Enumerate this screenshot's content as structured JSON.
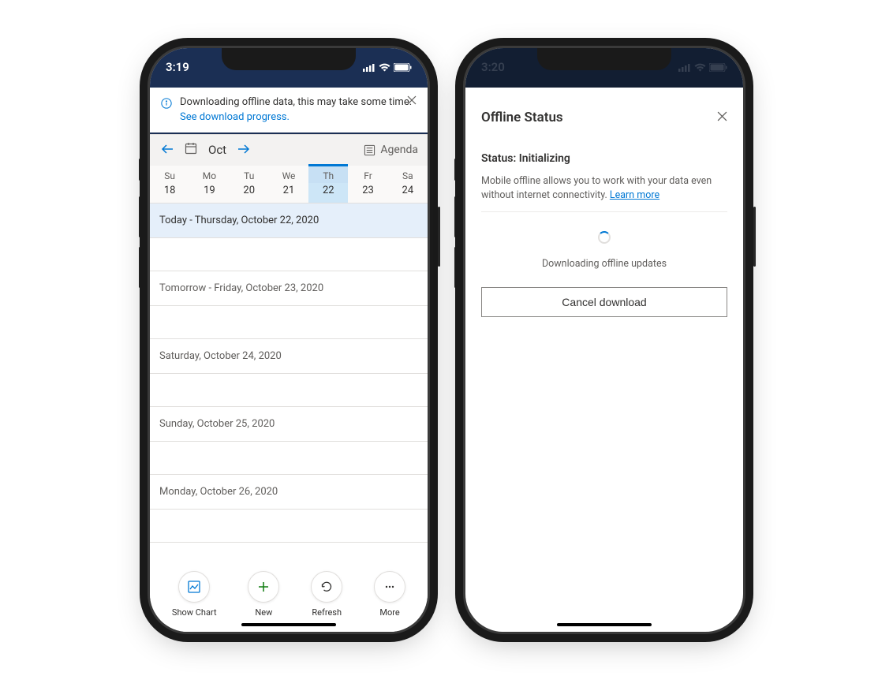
{
  "phone_left": {
    "status_time": "3:19",
    "banner": {
      "message": "Downloading offline data, this may take some time.",
      "link": "See download progress."
    },
    "calendar": {
      "month": "Oct",
      "agenda_label": "Agenda",
      "week_days": [
        "Su",
        "Mo",
        "Tu",
        "We",
        "Th",
        "Fr",
        "Sa"
      ],
      "week_dates": [
        "18",
        "19",
        "20",
        "21",
        "22",
        "23",
        "24"
      ],
      "selected_index": 4,
      "agenda_items": [
        "Today - Thursday, October 22, 2020",
        "Tomorrow - Friday, October 23, 2020",
        "Saturday, October 24, 2020",
        "Sunday, October 25, 2020",
        "Monday, October 26, 2020"
      ]
    },
    "bottom_buttons": [
      {
        "label": "Show Chart"
      },
      {
        "label": "New"
      },
      {
        "label": "Refresh"
      },
      {
        "label": "More"
      }
    ]
  },
  "phone_right": {
    "status_time": "3:20",
    "title": "Offline Status",
    "status_label": "Status: Initializing",
    "description": "Mobile offline allows you to work with your data even without internet connectivity.",
    "learn_more": "Learn more",
    "downloading_label": "Downloading offline updates",
    "cancel_label": "Cancel download"
  }
}
